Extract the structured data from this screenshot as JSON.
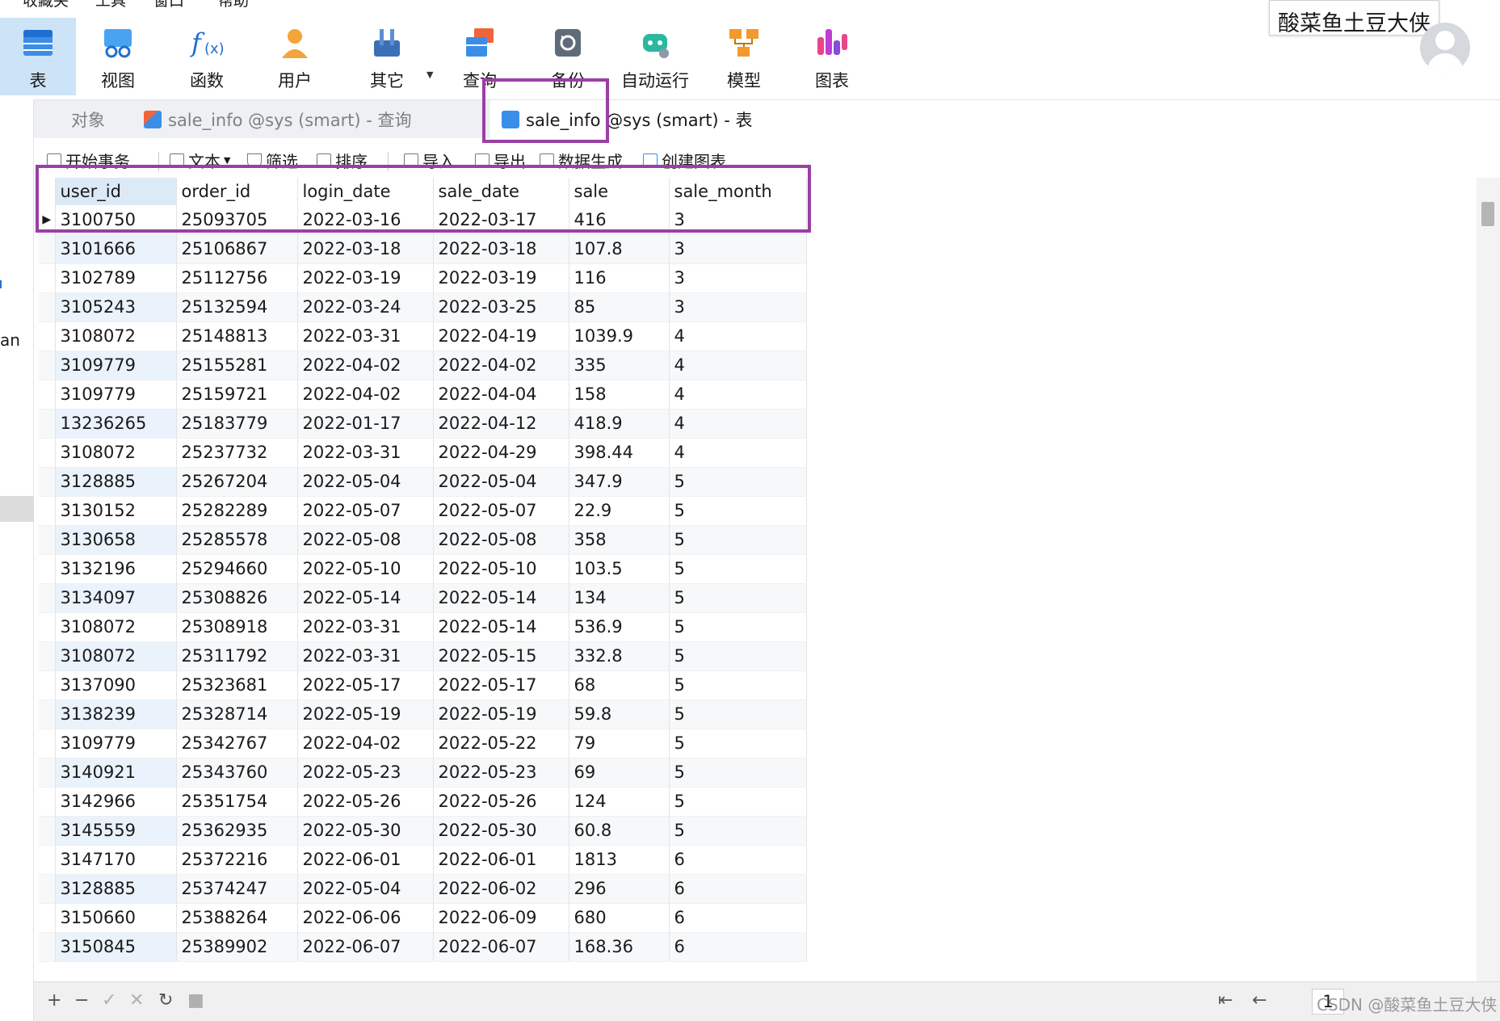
{
  "menu": [
    "收藏夹",
    "工具",
    "窗口",
    "帮助"
  ],
  "ribbon": [
    {
      "label": "表",
      "icon": "table-icon"
    },
    {
      "label": "视图",
      "icon": "view-icon"
    },
    {
      "label": "函数",
      "icon": "function-icon"
    },
    {
      "label": "用户",
      "icon": "user-icon"
    },
    {
      "label": "其它",
      "icon": "tools-icon"
    },
    {
      "label": "查询",
      "icon": "query-icon"
    },
    {
      "label": "备份",
      "icon": "backup-icon"
    },
    {
      "label": "自动运行",
      "icon": "robot-icon"
    },
    {
      "label": "模型",
      "icon": "model-icon"
    },
    {
      "label": "图表",
      "icon": "chart-icon"
    }
  ],
  "user": {
    "name": "酸菜鱼土豆大侠"
  },
  "tabs": [
    {
      "label": "对象"
    },
    {
      "label": "sale_info @sys (smart) - 查询"
    },
    {
      "label": "sale_info @sys (smart) - 表"
    }
  ],
  "toolbar": [
    "开始事务",
    "文本",
    "筛选",
    "排序",
    "导入",
    "导出",
    "数据生成",
    "创建图表"
  ],
  "left_fragment": "an",
  "columns": [
    "user_id",
    "order_id",
    "login_date",
    "sale_date",
    "sale",
    "sale_month"
  ],
  "rows": [
    [
      "3100750",
      "25093705",
      "2022-03-16",
      "2022-03-17",
      "416",
      "3"
    ],
    [
      "3101666",
      "25106867",
      "2022-03-18",
      "2022-03-18",
      "107.8",
      "3"
    ],
    [
      "3102789",
      "25112756",
      "2022-03-19",
      "2022-03-19",
      "116",
      "3"
    ],
    [
      "3105243",
      "25132594",
      "2022-03-24",
      "2022-03-25",
      "85",
      "3"
    ],
    [
      "3108072",
      "25148813",
      "2022-03-31",
      "2022-04-19",
      "1039.9",
      "4"
    ],
    [
      "3109779",
      "25155281",
      "2022-04-02",
      "2022-04-02",
      "335",
      "4"
    ],
    [
      "3109779",
      "25159721",
      "2022-04-02",
      "2022-04-04",
      "158",
      "4"
    ],
    [
      "13236265",
      "25183779",
      "2022-01-17",
      "2022-04-12",
      "418.9",
      "4"
    ],
    [
      "3108072",
      "25237732",
      "2022-03-31",
      "2022-04-29",
      "398.44",
      "4"
    ],
    [
      "3128885",
      "25267204",
      "2022-05-04",
      "2022-05-04",
      "347.9",
      "5"
    ],
    [
      "3130152",
      "25282289",
      "2022-05-07",
      "2022-05-07",
      "22.9",
      "5"
    ],
    [
      "3130658",
      "25285578",
      "2022-05-08",
      "2022-05-08",
      "358",
      "5"
    ],
    [
      "3132196",
      "25294660",
      "2022-05-10",
      "2022-05-10",
      "103.5",
      "5"
    ],
    [
      "3134097",
      "25308826",
      "2022-05-14",
      "2022-05-14",
      "134",
      "5"
    ],
    [
      "3108072",
      "25308918",
      "2022-03-31",
      "2022-05-14",
      "536.9",
      "5"
    ],
    [
      "3108072",
      "25311792",
      "2022-03-31",
      "2022-05-15",
      "332.8",
      "5"
    ],
    [
      "3137090",
      "25323681",
      "2022-05-17",
      "2022-05-17",
      "68",
      "5"
    ],
    [
      "3138239",
      "25328714",
      "2022-05-19",
      "2022-05-19",
      "59.8",
      "5"
    ],
    [
      "3109779",
      "25342767",
      "2022-04-02",
      "2022-05-22",
      "79",
      "5"
    ],
    [
      "3140921",
      "25343760",
      "2022-05-23",
      "2022-05-23",
      "69",
      "5"
    ],
    [
      "3142966",
      "25351754",
      "2022-05-26",
      "2022-05-26",
      "124",
      "5"
    ],
    [
      "3145559",
      "25362935",
      "2022-05-30",
      "2022-05-30",
      "60.8",
      "5"
    ],
    [
      "3147170",
      "25372216",
      "2022-06-01",
      "2022-06-01",
      "1813",
      "6"
    ],
    [
      "3128885",
      "25374247",
      "2022-05-04",
      "2022-06-02",
      "296",
      "6"
    ],
    [
      "3150660",
      "25388264",
      "2022-06-06",
      "2022-06-09",
      "680",
      "6"
    ],
    [
      "3150845",
      "25389902",
      "2022-06-07",
      "2022-06-07",
      "168.36",
      "6"
    ]
  ],
  "statusbar": {
    "buttons": [
      "+",
      "−",
      "✓",
      "✕",
      "↻",
      "■"
    ],
    "page": "1",
    "nav": [
      "⇤",
      "←",
      "→",
      "⇥",
      "⚙"
    ]
  },
  "watermark": "CSDN @酸菜鱼土豆大侠",
  "colors": {
    "highlight": "#9b3fa5",
    "active_ribbon": "#cde3f7",
    "tab_bar": "#eef0f3"
  }
}
